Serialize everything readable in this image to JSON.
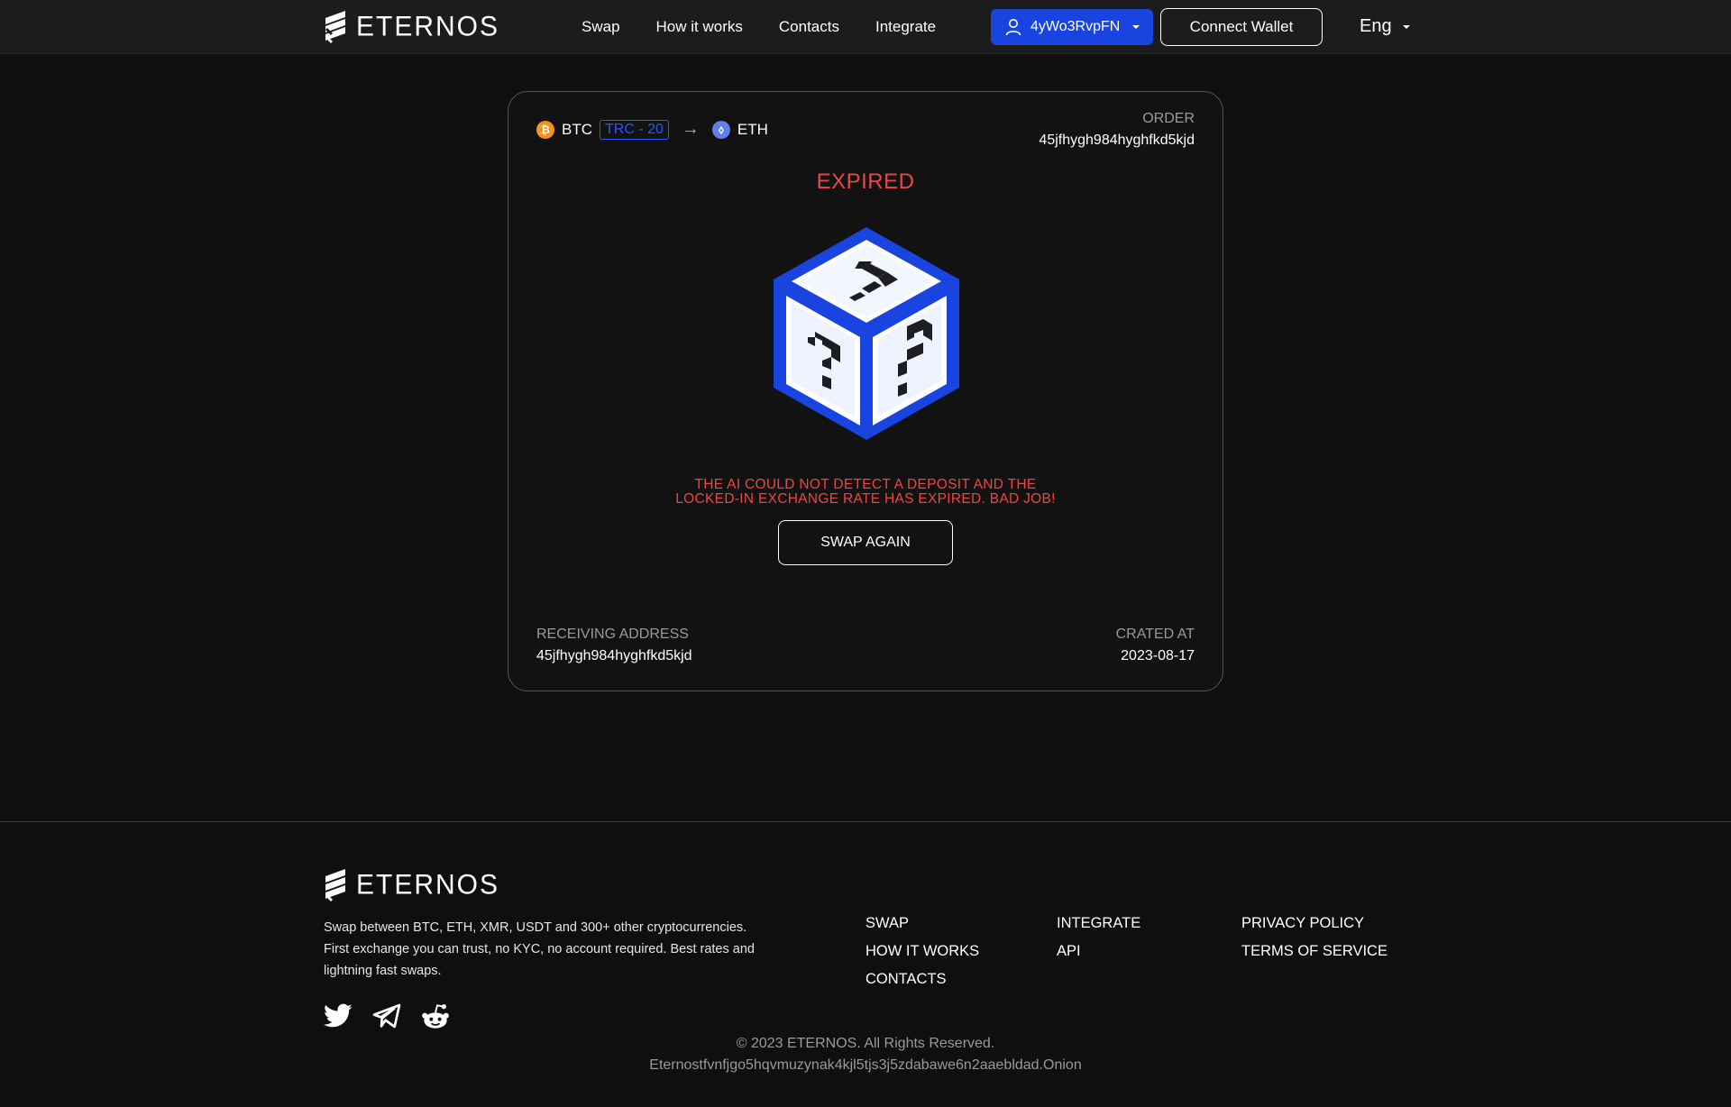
{
  "brand": {
    "name": "ETERNOS"
  },
  "header": {
    "nav": [
      "Swap",
      "How it works",
      "Contacts",
      "Integrate"
    ],
    "wallet_address": "4yWo3RvpFN",
    "connect_label": "Connect Wallet",
    "language": "Eng"
  },
  "order": {
    "from_coin": "BTC",
    "network": "TRC - 20",
    "arrow": "→",
    "to_coin": "ETH",
    "order_label": "ORDER",
    "order_id": "45jfhygh984hyghfkd5kjd",
    "status": "EXPIRED",
    "message_line1": "THE AI COULD NOT DETECT A DEPOSIT AND THE",
    "message_line2": "LOCKED-IN EXCHANGE RATE HAS EXPIRED. BAD JOB!",
    "swap_again_label": "SWAP AGAIN",
    "receiving_label": "RECEIVING ADDRESS",
    "receiving_address": "45jfhygh984hyghfkd5kjd",
    "created_label": "CRATED AT",
    "created_date": "2023-08-17"
  },
  "icons": {
    "btc": "₿",
    "eth": "⬨"
  },
  "colors": {
    "accent_blue": "#1a44e0",
    "status_red": "#ef4444",
    "btc_orange": "#f7931a",
    "eth_purple": "#627eea"
  },
  "footer": {
    "description": "Swap between BTC, ETH, XMR, USDT and 300+ other cryptocurrencies. First exchange you can trust, no KYC, no account required. Best rates and lightning fast swaps.",
    "col1": [
      "SWAP",
      "HOW IT WORKS",
      "CONTACTS"
    ],
    "col2": [
      "INTEGRATE",
      "API"
    ],
    "col3": [
      "PRIVACY POLICY",
      "TERMS OF SERVICE"
    ],
    "copyright": "© 2023 ETERNOS. All Rights Reserved.",
    "onion": "Eternostfvnfjgo5hqvmuzynak4kjl5tjs3j5zdabawe6n2aaebldad.Onion"
  }
}
